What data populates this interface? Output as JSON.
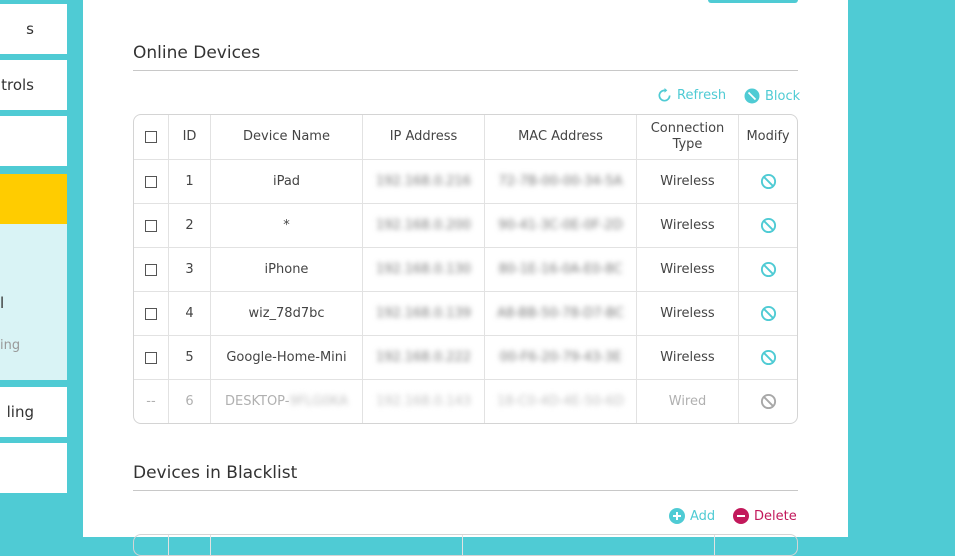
{
  "nav": {
    "items": [
      "s",
      "trols",
      "",
      "l",
      "ing",
      "ling",
      ""
    ],
    "active_color": "#ffcc00"
  },
  "online": {
    "title": "Online Devices",
    "refresh_label": "Refresh",
    "block_label": "Block",
    "headers": {
      "id": "ID",
      "name": "Device Name",
      "ip": "IP Address",
      "mac": "MAC Address",
      "conn": "Connection Type",
      "modify": "Modify"
    },
    "rows": [
      {
        "check": "",
        "id": "1",
        "name": "iPad",
        "ip": "192.168.0.216",
        "mac": "72-7B-00-00-34-5A",
        "conn": "Wireless",
        "modify_icon": "block-icon"
      },
      {
        "check": "",
        "id": "2",
        "name": "*",
        "ip": "192.168.0.200",
        "mac": "90-41-3C-0E-0F-2D",
        "conn": "Wireless",
        "modify_icon": "block-icon"
      },
      {
        "check": "",
        "id": "3",
        "name": "iPhone",
        "ip": "192.168.0.130",
        "mac": "80-1E-16-0A-E0-8C",
        "conn": "Wireless",
        "modify_icon": "block-icon"
      },
      {
        "check": "",
        "id": "4",
        "name": "wiz_78d7bc",
        "ip": "192.168.0.139",
        "mac": "A8-BB-50-78-D7-BC",
        "conn": "Wireless",
        "modify_icon": "block-icon"
      },
      {
        "check": "",
        "id": "5",
        "name": "Google-Home-Mini",
        "ip": "192.168.0.222",
        "mac": "00-F6-20-79-43-3E",
        "conn": "Wireless",
        "modify_icon": "block-icon"
      },
      {
        "check": "--",
        "id": "6",
        "name": "DESKTOP-",
        "name_hidden": "9FLG0KA",
        "ip": "192.168.0.143",
        "mac": "18-C0-4D-4E-50-6D",
        "conn": "Wired",
        "modify_icon": "block-icon"
      }
    ]
  },
  "blacklist": {
    "title": "Devices in Blacklist",
    "add_label": "Add",
    "delete_label": "Delete"
  },
  "colors": {
    "accent": "#4fcbd4",
    "delete": "#c2185b",
    "highlight": "#ffcc00"
  }
}
